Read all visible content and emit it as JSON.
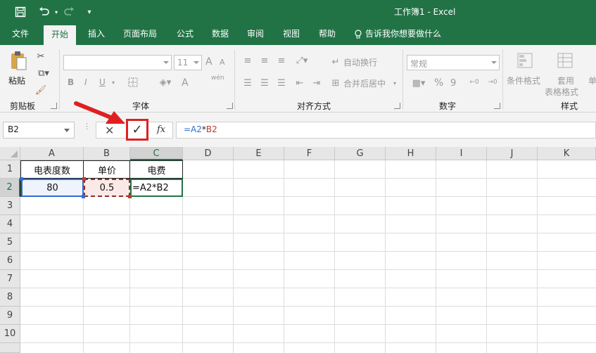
{
  "window": {
    "title": "工作簿1  -  Excel"
  },
  "tabs": [
    {
      "label": "文件"
    },
    {
      "label": "开始"
    },
    {
      "label": "插入"
    },
    {
      "label": "页面布局"
    },
    {
      "label": "公式"
    },
    {
      "label": "数据"
    },
    {
      "label": "审阅"
    },
    {
      "label": "视图"
    },
    {
      "label": "帮助"
    }
  ],
  "tell_me": "告诉我你想要做什么",
  "ribbon": {
    "clipboard": {
      "paste": "粘贴",
      "label": "剪贴板"
    },
    "font": {
      "label": "字体",
      "size": "11",
      "bold": "B",
      "italic": "I",
      "underline": "U",
      "grow": "A",
      "shrink": "A",
      "color": "A",
      "phonetic": "wén"
    },
    "alignment": {
      "label": "对齐方式",
      "wrap": "自动换行",
      "merge": "合并后居中"
    },
    "number": {
      "label": "数字",
      "format": "常规",
      "percent": "%",
      "comma": "9"
    },
    "styles": {
      "label": "样式",
      "cond": "条件格式",
      "table1": "套用",
      "table2": "表格格式",
      "cell": "单"
    }
  },
  "formula_bar": {
    "name_box": "B2",
    "cancel": "✕",
    "enter": "✓",
    "fx": "fx",
    "formula_a": "=A2",
    "formula_op": "*",
    "formula_b": "B2"
  },
  "columns": [
    "A",
    "B",
    "C",
    "D",
    "E",
    "F",
    "G",
    "H",
    "I",
    "J",
    "K"
  ],
  "rows": [
    "1",
    "2",
    "3",
    "4",
    "5",
    "6",
    "7",
    "8",
    "9",
    "10"
  ],
  "cells": {
    "A1": "电表度数",
    "B1": "单价",
    "C1": "电费",
    "A2": "80",
    "B2": "0.5",
    "C2": "=A2*B2"
  },
  "colors": {
    "accent": "#217346",
    "annotation": "#e02020",
    "ref_blue": "#2f6ed1",
    "ref_red": "#c0392b"
  }
}
